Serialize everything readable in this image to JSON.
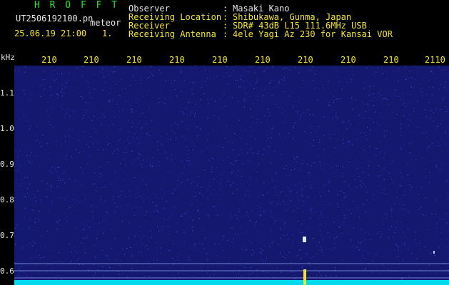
{
  "header": {
    "app_title": "H R O F F T",
    "filename": "UT2506192100.pn",
    "mode": "meteor",
    "datetime": "25.06.19 21:00",
    "index": "1.",
    "fields": [
      {
        "label": "Observer",
        "sep": ":",
        "value": "Masaki Kano"
      },
      {
        "label": "Receiving Location",
        "sep": ":",
        "value": "Shibukawa, Gunma, Japan"
      },
      {
        "label": "Receiver",
        "sep": ":",
        "value": "SDR# 43dB L15 111.6MHz USB"
      },
      {
        "label": "Receiving Antenna",
        "sep": ":",
        "value": "4ele Yagi Az 230 for Kansai VOR"
      }
    ]
  },
  "axis": {
    "y_unit": "kHz",
    "y_ticks": [
      "1.1",
      "1.0",
      "0.9",
      "0.8",
      "0.7",
      "0.6"
    ],
    "x_ticks": [
      "210",
      "210",
      "210",
      "210",
      "210",
      "210",
      "210",
      "210",
      "210",
      "2110"
    ]
  },
  "colors": {
    "background": "#000000",
    "noise": "#1a1f8c",
    "signal": "#f5e52a",
    "baseline": "#00e5ff",
    "label_yellow": "#f5e52a",
    "label_green": "#27e827"
  }
}
